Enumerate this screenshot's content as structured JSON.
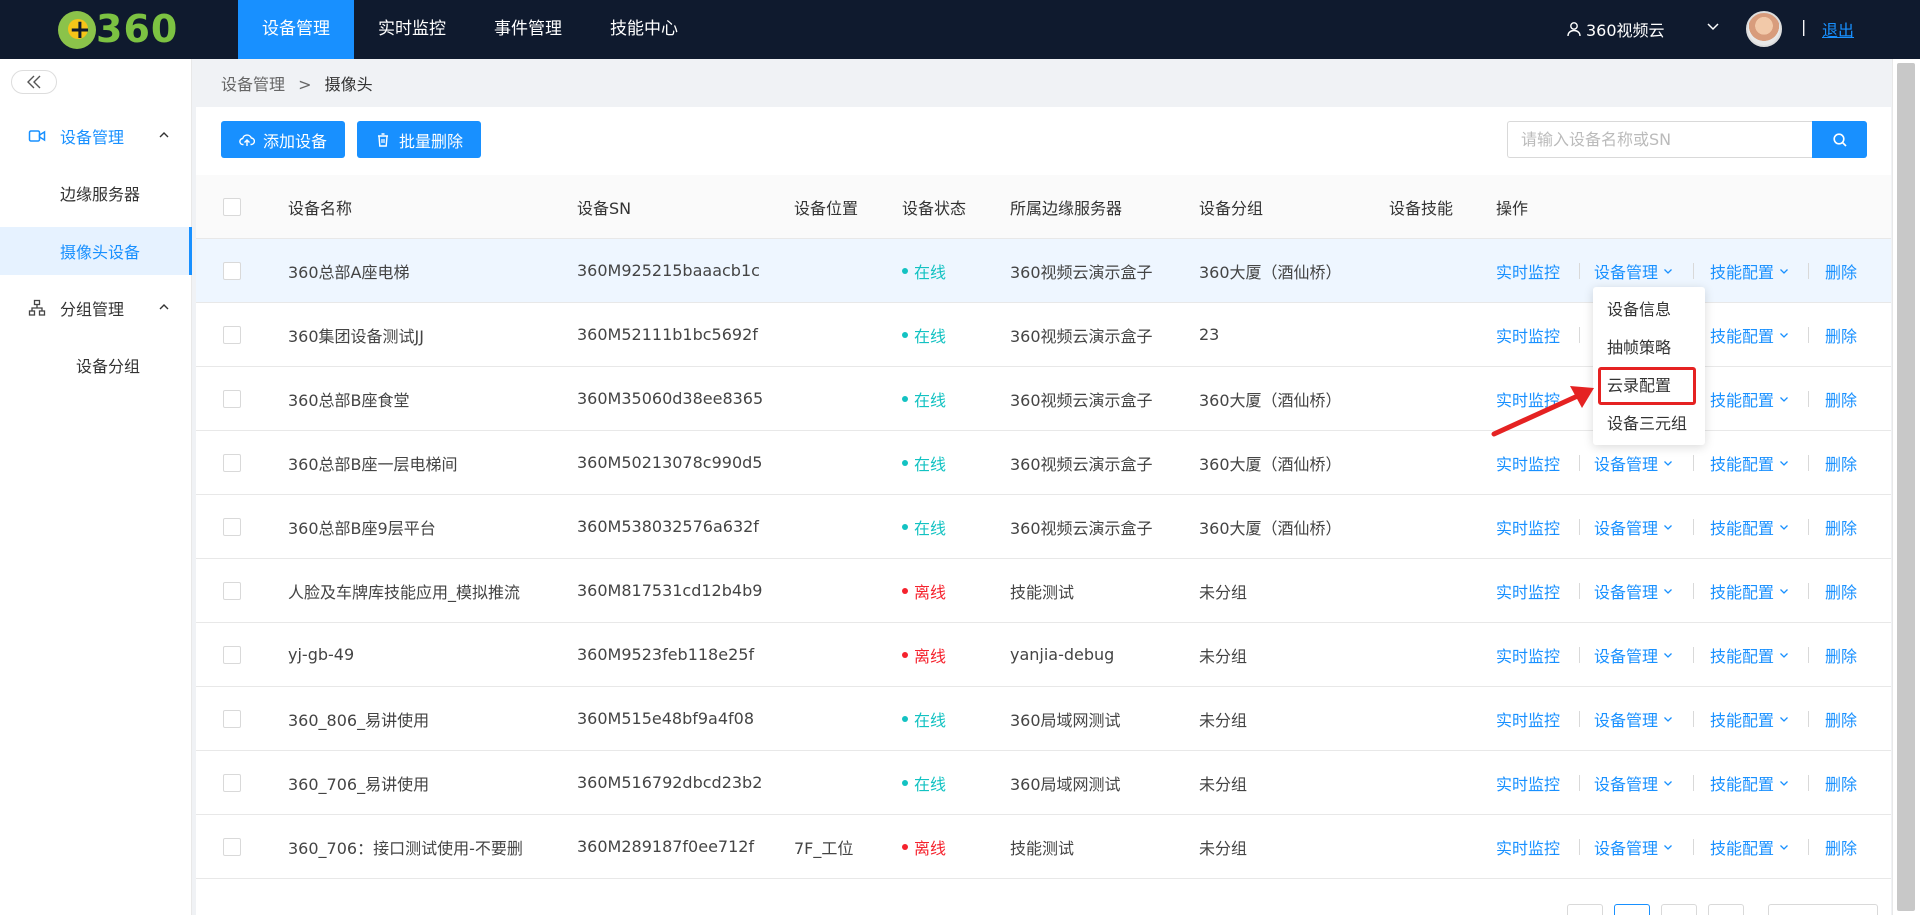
{
  "header": {
    "logo_text": "360",
    "nav": [
      {
        "label": "设备管理",
        "active": true
      },
      {
        "label": "实时监控",
        "active": false
      },
      {
        "label": "事件管理",
        "active": false
      },
      {
        "label": "技能中心",
        "active": false
      }
    ],
    "user_name": "360视频云",
    "separator": "|",
    "logout": "退出"
  },
  "sidebar": {
    "groups": [
      {
        "label": "设备管理",
        "icon": "camera-icon",
        "items": [
          "边缘服务器",
          "摄像头设备"
        ]
      },
      {
        "label": "分组管理",
        "icon": "org-tree-icon",
        "items": [
          "设备分组"
        ]
      }
    ],
    "active_item": "摄像头设备"
  },
  "breadcrumb": {
    "parent": "设备管理",
    "separator": ">",
    "current": "摄像头"
  },
  "toolbar": {
    "add_label": "添加设备",
    "batch_delete_label": "批量删除",
    "search_placeholder": "请输入设备名称或SN"
  },
  "table": {
    "columns": [
      "设备名称",
      "设备SN",
      "设备位置",
      "设备状态",
      "所属边缘服务器",
      "设备分组",
      "设备技能",
      "操作"
    ],
    "ops": {
      "live": "实时监控",
      "manage": "设备管理",
      "skill": "技能配置",
      "delete": "删除"
    },
    "rows": [
      {
        "name": "360总部A座电梯",
        "sn": "360M925215baaacb1c",
        "location": "",
        "status": "在线",
        "online": true,
        "server": "360视频云演示盒子",
        "group": "360大厦（酒仙桥）",
        "skill": ""
      },
      {
        "name": "360集团设备测试JJ",
        "sn": "360M52111b1bc5692f",
        "location": "",
        "status": "在线",
        "online": true,
        "server": "360视频云演示盒子",
        "group": "23",
        "skill": ""
      },
      {
        "name": "360总部B座食堂",
        "sn": "360M35060d38ee8365",
        "location": "",
        "status": "在线",
        "online": true,
        "server": "360视频云演示盒子",
        "group": "360大厦（酒仙桥）",
        "skill": ""
      },
      {
        "name": "360总部B座一层电梯间",
        "sn": "360M50213078c990d5",
        "location": "",
        "status": "在线",
        "online": true,
        "server": "360视频云演示盒子",
        "group": "360大厦（酒仙桥）",
        "skill": ""
      },
      {
        "name": "360总部B座9层平台",
        "sn": "360M538032576a632f",
        "location": "",
        "status": "在线",
        "online": true,
        "server": "360视频云演示盒子",
        "group": "360大厦（酒仙桥）",
        "skill": ""
      },
      {
        "name": "人脸及车牌库技能应用_模拟推流",
        "sn": "360M817531cd12b4b9",
        "location": "",
        "status": "离线",
        "online": false,
        "server": "技能测试",
        "group": "未分组",
        "skill": ""
      },
      {
        "name": "yj-gb-49",
        "sn": "360M9523feb118e25f",
        "location": "",
        "status": "离线",
        "online": false,
        "server": "yanjia-debug",
        "group": "未分组",
        "skill": ""
      },
      {
        "name": "360_806_易讲使用",
        "sn": "360M515e48bf9a4f08",
        "location": "",
        "status": "在线",
        "online": true,
        "server": "360局域网测试",
        "group": "未分组",
        "skill": ""
      },
      {
        "name": "360_706_易讲使用",
        "sn": "360M516792dbcd23b2",
        "location": "",
        "status": "在线",
        "online": true,
        "server": "360局域网测试",
        "group": "未分组",
        "skill": ""
      },
      {
        "name": "360_706：接口测试使用-不要删",
        "sn": "360M289187f0ee712f",
        "location": "7F_工位",
        "status": "离线",
        "online": false,
        "server": "技能测试",
        "group": "未分组",
        "skill": ""
      }
    ]
  },
  "dropdown": {
    "items": [
      "设备信息",
      "抽帧策略",
      "云录配置",
      "设备三元组"
    ],
    "highlighted": "云录配置"
  },
  "colors": {
    "accent": "#1890ff",
    "online": "#13c2c2",
    "offline": "#f5222d",
    "topbar": "#0f1a2e",
    "annotation": "#e52222"
  }
}
